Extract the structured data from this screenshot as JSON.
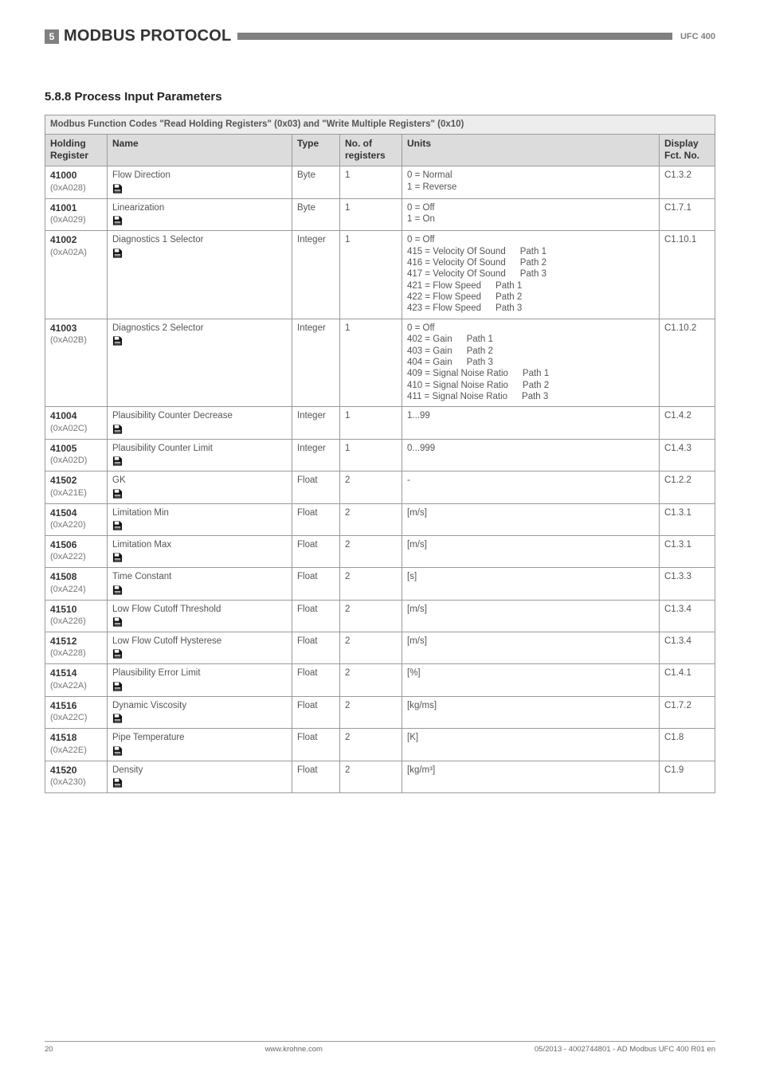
{
  "header": {
    "chapter_num": "5",
    "chapter_title": "MODBUS PROTOCOL",
    "doc_id": "UFC 400"
  },
  "section_title": "5.8.8  Process Input Parameters",
  "table": {
    "caption": "Modbus Function Codes \"Read Holding Registers\" (0x03) and \"Write Multiple Registers\" (0x10)",
    "columns": {
      "hold": "Holding Register",
      "name": "Name",
      "type": "Type",
      "nregs": "No. of registers",
      "units": "Units",
      "disp": "Display Fct. No."
    },
    "rows": [
      {
        "dec": "41000",
        "hex": "(0xA028)",
        "name": "Flow Direction",
        "type": "Byte",
        "nregs": "1",
        "units": "0 = Normal\n1 = Reverse",
        "disp": "C1.3.2"
      },
      {
        "dec": "41001",
        "hex": "(0xA029)",
        "name": "Linearization",
        "type": "Byte",
        "nregs": "1",
        "units": "0 = Off\n1 = On",
        "disp": "C1.7.1"
      },
      {
        "dec": "41002",
        "hex": "(0xA02A)",
        "name": "Diagnostics 1 Selector",
        "type": "Integer",
        "nregs": "1",
        "units": "0 = Off\n415 = Velocity Of Sound    Path 1\n416 = Velocity Of Sound    Path 2\n417 = Velocity Of Sound    Path 3\n421 = Flow Speed    Path 1\n422 = Flow Speed    Path 2\n423 = Flow Speed    Path 3",
        "disp": "C1.10.1"
      },
      {
        "dec": "41003",
        "hex": "(0xA02B)",
        "name": "Diagnostics 2 Selector",
        "type": "Integer",
        "nregs": "1",
        "units": "0 = Off\n402 = Gain    Path 1\n403 = Gain    Path 2\n404 = Gain    Path 3\n409 = Signal Noise Ratio    Path 1\n410 = Signal Noise Ratio    Path 2\n411 = Signal Noise Ratio    Path 3",
        "disp": "C1.10.2"
      },
      {
        "dec": "41004",
        "hex": "(0xA02C)",
        "name": "Plausibility Counter Decrease",
        "type": "Integer",
        "nregs": "1",
        "units": "1...99",
        "disp": "C1.4.2"
      },
      {
        "dec": "41005",
        "hex": "(0xA02D)",
        "name": "Plausibility Counter Limit",
        "type": "Integer",
        "nregs": "1",
        "units": "0...999",
        "disp": "C1.4.3"
      },
      {
        "dec": "41502",
        "hex": "(0xA21E)",
        "name": "GK",
        "type": "Float",
        "nregs": "2",
        "units": "-",
        "disp": "C1.2.2"
      },
      {
        "dec": "41504",
        "hex": "(0xA220)",
        "name": "Limitation Min",
        "type": "Float",
        "nregs": "2",
        "units": "[m/s]",
        "disp": "C1.3.1"
      },
      {
        "dec": "41506",
        "hex": "(0xA222)",
        "name": "Limitation Max",
        "type": "Float",
        "nregs": "2",
        "units": "[m/s]",
        "disp": "C1.3.1"
      },
      {
        "dec": "41508",
        "hex": "(0xA224)",
        "name": "Time Constant",
        "type": "Float",
        "nregs": "2",
        "units": "[s]",
        "disp": "C1.3.3"
      },
      {
        "dec": "41510",
        "hex": "(0xA226)",
        "name": "Low Flow Cutoff Threshold",
        "type": "Float",
        "nregs": "2",
        "units": "[m/s]",
        "disp": "C1.3.4"
      },
      {
        "dec": "41512",
        "hex": "(0xA228)",
        "name": "Low Flow Cutoff Hysterese",
        "type": "Float",
        "nregs": "2",
        "units": "[m/s]",
        "disp": "C1.3.4"
      },
      {
        "dec": "41514",
        "hex": "(0xA22A)",
        "name": "Plausibility Error Limit",
        "type": "Float",
        "nregs": "2",
        "units": "[%]",
        "disp": "C1.4.1"
      },
      {
        "dec": "41516",
        "hex": "(0xA22C)",
        "name": "Dynamic Viscosity",
        "type": "Float",
        "nregs": "2",
        "units": "[kg/ms]",
        "disp": "C1.7.2"
      },
      {
        "dec": "41518",
        "hex": "(0xA22E)",
        "name": "Pipe Temperature",
        "type": "Float",
        "nregs": "2",
        "units": "[K]",
        "disp": "C1.8"
      },
      {
        "dec": "41520",
        "hex": "(0xA230)",
        "name": "Density",
        "type": "Float",
        "nregs": "2",
        "units": "[kg/m³]",
        "disp": "C1.9"
      }
    ]
  },
  "footer": {
    "page": "20",
    "site": "www.krohne.com",
    "docref": "05/2013 - 4002744801 - AD Modbus UFC 400 R01 en"
  }
}
